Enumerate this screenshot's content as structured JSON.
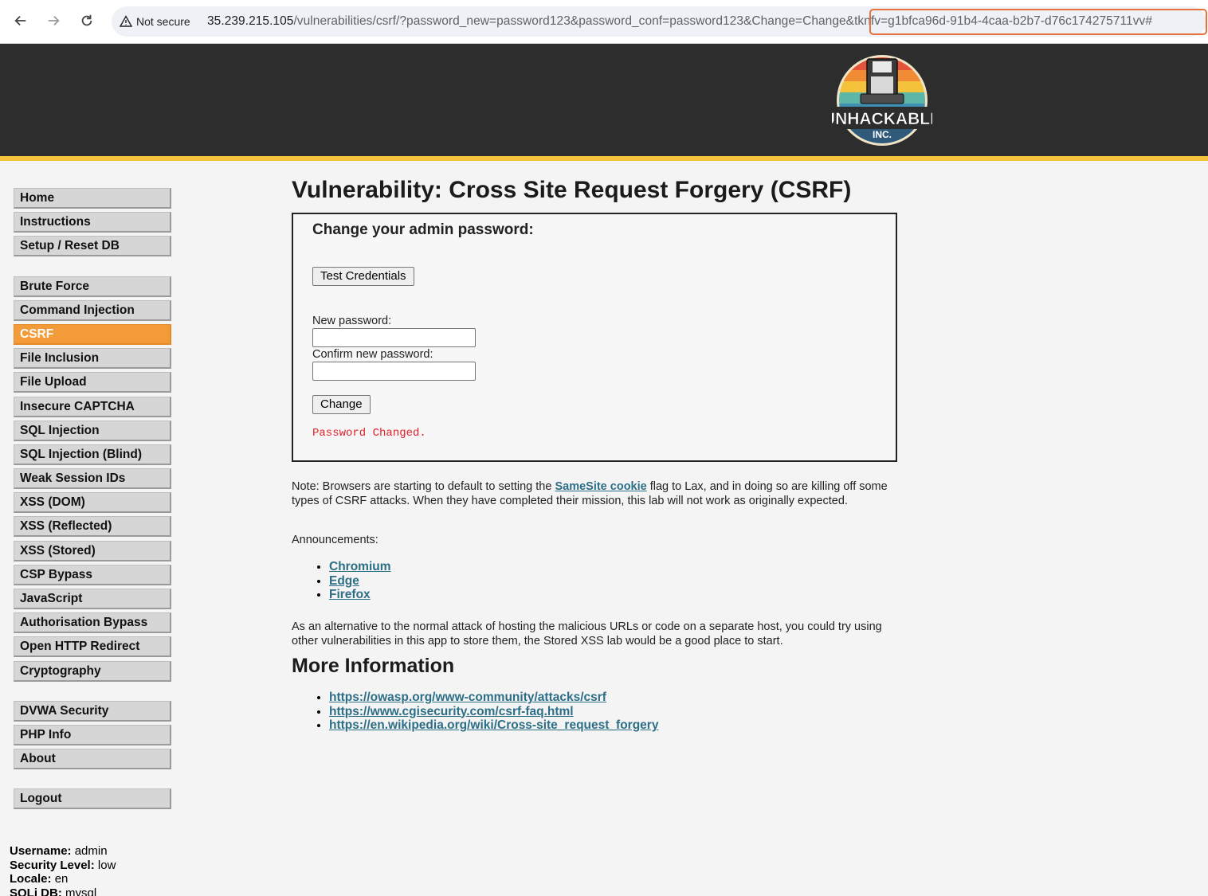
{
  "browser": {
    "security_label": "Not secure",
    "url_host": "35.239.215.105",
    "url_path": "/vulnerabilities/csrf/?password_new=password123&password_conf=password123&Change=Change&tknfv=g1bfca96d-91b4-4caa-b2b7-d76c174275711vv#"
  },
  "logo": {
    "text_main": "UNHACKABLE",
    "text_sub": "INC."
  },
  "menu": {
    "group1": [
      "Home",
      "Instructions",
      "Setup / Reset DB"
    ],
    "group2": [
      "Brute Force",
      "Command Injection",
      "CSRF",
      "File Inclusion",
      "File Upload",
      "Insecure CAPTCHA",
      "SQL Injection",
      "SQL Injection (Blind)",
      "Weak Session IDs",
      "XSS (DOM)",
      "XSS (Reflected)",
      "XSS (Stored)",
      "CSP Bypass",
      "JavaScript",
      "Authorisation Bypass",
      "Open HTTP Redirect",
      "Cryptography"
    ],
    "group3": [
      "DVWA Security",
      "PHP Info",
      "About"
    ],
    "group4": [
      "Logout"
    ],
    "active": "CSRF"
  },
  "status": {
    "username_label": "Username:",
    "username": "admin",
    "security_label": "Security Level:",
    "security": "low",
    "locale_label": "Locale:",
    "locale": "en",
    "db_label": "SQLi DB:",
    "db": "mysql"
  },
  "main": {
    "title": "Vulnerability: Cross Site Request Forgery (CSRF)",
    "form_heading": "Change your admin password:",
    "test_button": "Test Credentials",
    "new_password_label": "New password:",
    "new_password_value": "",
    "confirm_password_label": "Confirm new password:",
    "confirm_password_value": "",
    "change_button": "Change",
    "result_message": "Password Changed.",
    "note_before": "Note: Browsers are starting to default to setting the ",
    "note_link": "SameSite cookie",
    "note_after": " flag to Lax, and in doing so are killing off some types of CSRF attacks. When they have completed their mission, this lab will not work as originally expected.",
    "announcements_label": "Announcements:",
    "announcements": [
      "Chromium",
      "Edge",
      "Firefox"
    ],
    "alternative_text": "As an alternative to the normal attack of hosting the malicious URLs or code on a separate host, you could try using other vulnerabilities in this app to store them, the Stored XSS lab would be a good place to start.",
    "more_info_heading": "More Information",
    "more_info_links": [
      "https://owasp.org/www-community/attacks/csrf",
      "https://www.cgisecurity.com/csrf-faq.html",
      "https://en.wikipedia.org/wiki/Cross-site_request_forgery"
    ]
  }
}
